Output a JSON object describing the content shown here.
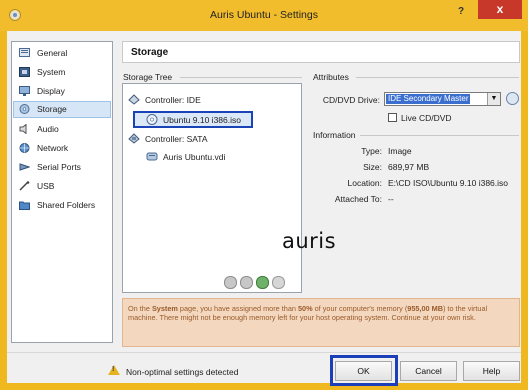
{
  "window": {
    "title": "Auris Ubuntu - Settings",
    "help_label": "?",
    "close_label": "x"
  },
  "sidebar": {
    "items": [
      {
        "label": "General",
        "icon": "general-icon"
      },
      {
        "label": "System",
        "icon": "system-icon"
      },
      {
        "label": "Display",
        "icon": "display-icon"
      },
      {
        "label": "Storage",
        "icon": "storage-icon",
        "selected": true
      },
      {
        "label": "Audio",
        "icon": "audio-icon"
      },
      {
        "label": "Network",
        "icon": "network-icon"
      },
      {
        "label": "Serial Ports",
        "icon": "serial-ports-icon"
      },
      {
        "label": "USB",
        "icon": "usb-icon"
      },
      {
        "label": "Shared Folders",
        "icon": "shared-folders-icon"
      }
    ]
  },
  "page": {
    "title": "Storage"
  },
  "storage_tree": {
    "label": "Storage Tree",
    "controller_ide": "Controller: IDE",
    "ide_disc": "Ubuntu 9.10 i386.iso",
    "controller_sata": "Controller: SATA",
    "sata_disk": "Auris Ubuntu.vdi"
  },
  "attributes": {
    "label": "Attributes",
    "drive_label": "CD/DVD Drive:",
    "drive_value": "IDE Secondary Master",
    "live_label": "Live CD/DVD",
    "live_checked": false
  },
  "information": {
    "label": "Information",
    "type_label": "Type:",
    "type_value": "Image",
    "size_label": "Size:",
    "size_value": "689,97 MB",
    "location_label": "Location:",
    "location_value": "E:\\CD ISO\\Ubuntu 9.10 i386.iso",
    "attached_label": "Attached To:",
    "attached_value": "--"
  },
  "overlay_text": "auris",
  "warning": {
    "part1": "On the ",
    "page_name": "System",
    "part2": " page, you have assigned more than ",
    "percent": "50%",
    "part3": " of your computer's memory (",
    "memory": "955,00 MB",
    "part4": ") to the virtual machine. There might not be enough memory left for your host operating system. Continue at your own risk."
  },
  "footer": {
    "status": "Non-optimal settings detected",
    "ok_label": "OK",
    "cancel_label": "Cancel",
    "help_label": "Help"
  },
  "colors": {
    "title_bar": "#f2bd2c",
    "selection_highlight": "#1a43b8",
    "warning_bg": "#f3d8bf",
    "warning_text": "#9a5a2a"
  }
}
